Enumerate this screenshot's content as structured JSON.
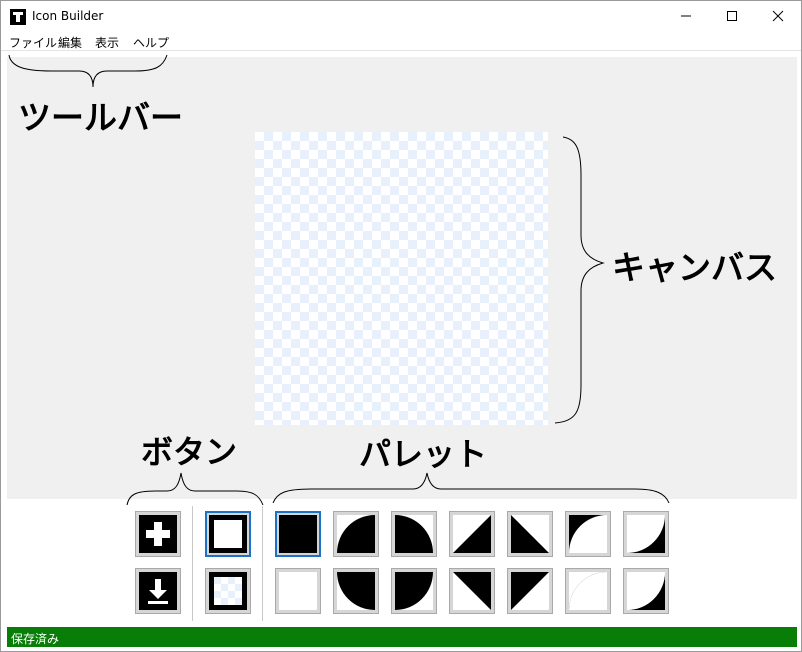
{
  "window": {
    "title": "Icon Builder"
  },
  "menu": {
    "items": [
      "ファイル",
      "編集",
      "表示",
      "ヘルプ"
    ]
  },
  "annotations": {
    "toolbar": "ツールバー",
    "canvas": "キャンバス",
    "buttons": "ボタン",
    "palette": "パレット"
  },
  "buttons": [
    {
      "icon": "plus-icon"
    },
    {
      "icon": "download-icon"
    },
    {
      "icon": "square-outline-icon",
      "selected": true
    },
    {
      "icon": "transparent-square-icon"
    }
  ],
  "palette": {
    "row1": [
      "black-square-icon",
      "quarter-circle-top-right-icon",
      "half-circle-right-icon",
      "triangle-bottom-right-icon",
      "triangle-bottom-left-icon",
      "half-circle-cut-left-icon",
      "half-circle-cut-right-icon"
    ],
    "row2": [
      "white-square-icon",
      "quarter-circle-bottom-right-icon",
      "quarter-circle-bottom-left-icon",
      "triangle-top-right-icon",
      "triangle-top-left-icon",
      "quarter-circle-cut-bottom-left-icon",
      "quarter-circle-cut-bottom-right-icon"
    ],
    "selected_index": 0
  },
  "status": {
    "text": "保存済み"
  },
  "colors": {
    "status_bar": "#087d08",
    "selection": "#1a73c8",
    "workspace": "#f0f0f0"
  }
}
